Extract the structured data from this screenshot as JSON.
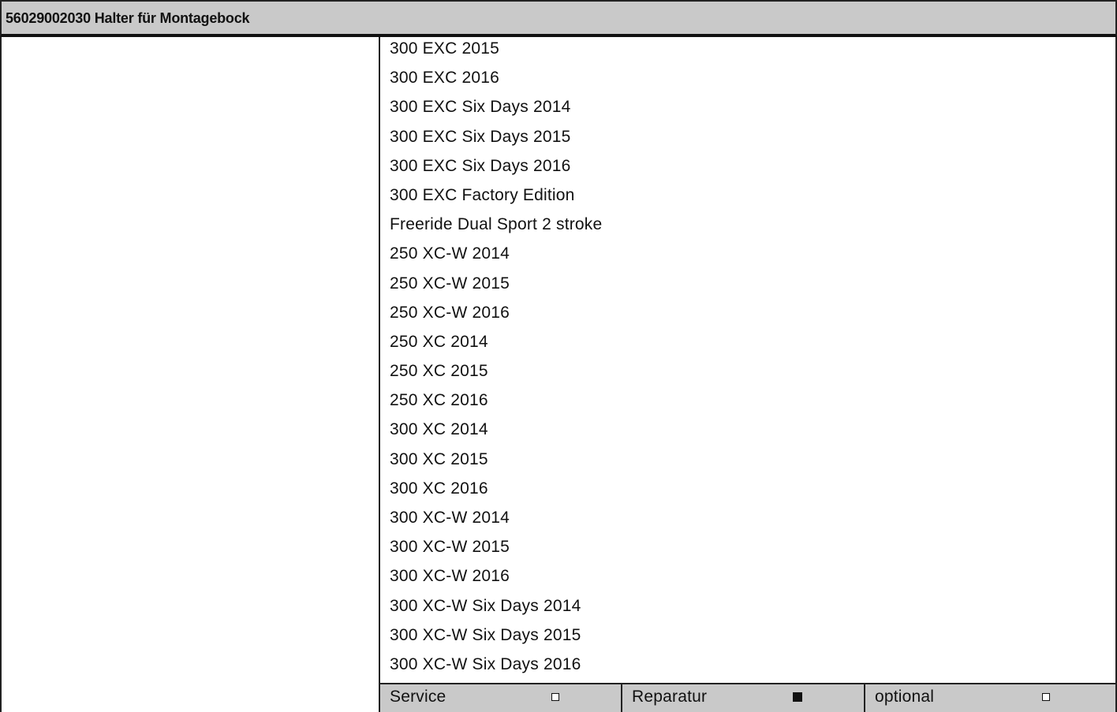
{
  "header": {
    "title": "56029002030 Halter für Montagebock"
  },
  "models": [
    "300 EXC 2015",
    "300 EXC 2016",
    "300 EXC Six Days 2014",
    "300 EXC Six Days 2015",
    "300 EXC Six Days 2016",
    "300 EXC Factory Edition",
    "Freeride Dual Sport 2 stroke",
    "250 XC-W 2014",
    "250 XC-W 2015",
    "250 XC-W 2016",
    "250 XC 2014",
    "250 XC 2015",
    "250 XC 2016",
    "300 XC 2014",
    "300 XC 2015",
    "300 XC 2016",
    "300 XC-W 2014",
    "300 XC-W 2015",
    "300 XC-W 2016",
    "300 XC-W Six Days 2014",
    "300 XC-W Six Days 2015",
    "300 XC-W Six Days 2016"
  ],
  "footer": {
    "service": {
      "label": "Service",
      "checked": false
    },
    "reparatur": {
      "label": "Reparatur",
      "checked": true
    },
    "optional": {
      "label": "optional",
      "checked": false
    }
  }
}
